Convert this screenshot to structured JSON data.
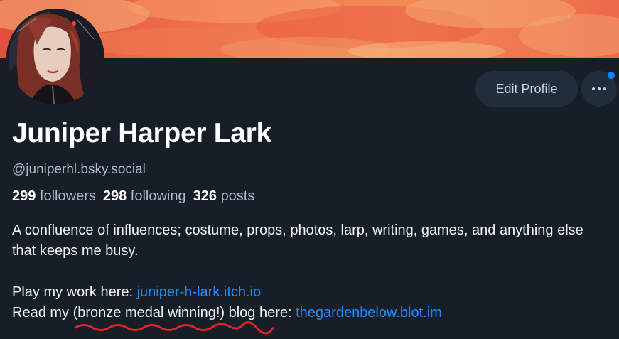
{
  "profile": {
    "display_name": "Juniper Harper Lark",
    "handle": "@juniperhl.bsky.social",
    "stats": {
      "followers_count": "299",
      "followers_label": "followers",
      "following_count": "298",
      "following_label": "following",
      "posts_count": "326",
      "posts_label": "posts"
    },
    "bio": {
      "line1": "A confluence of influences; costume, props, photos, larp, writing, games, and anything else that keeps me busy.",
      "play_prefix": "Play my work here: ",
      "play_link": "juniper-h-lark.itch.io",
      "read_prefix": "Read my ",
      "read_emphasis": "(bronze medal winning!)",
      "read_middle": " blog here: ",
      "read_link": "thegardenbelow.blot.im"
    }
  },
  "actions": {
    "edit_label": "Edit Profile",
    "more_icon": "ellipsis-icon"
  },
  "colors": {
    "background": "#161e27",
    "button_bg": "#212d3b",
    "link": "#208bfe",
    "notification": "#1083fe",
    "annotation": "#e0202a"
  }
}
